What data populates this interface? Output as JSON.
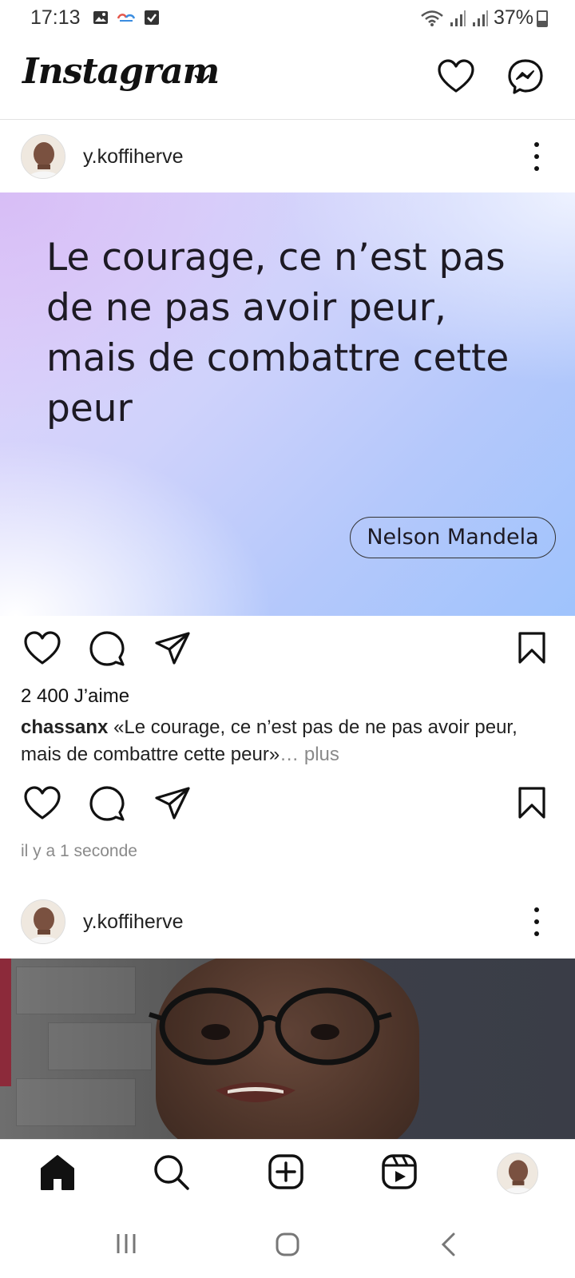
{
  "status_bar": {
    "time": "17:13",
    "battery": "37%",
    "battery_level": 0.37,
    "left_icons": [
      "image-icon",
      "cloud-icon",
      "checkbox-icon"
    ],
    "right_icons": [
      "wifi-icon",
      "signal-icon",
      "signal-icon"
    ]
  },
  "header": {
    "logo": "Instagram",
    "icons": [
      "chevron-down-icon",
      "heart-icon",
      "messenger-icon"
    ]
  },
  "posts": [
    {
      "username": "y.koffiherve",
      "quote_lines": [
        "Le courage, ce n’est pas",
        "de ne pas avoir peur,",
        "mais de combattre cette",
        "peur"
      ],
      "author": "Nelson Mandela",
      "likes": "2 400 J’aime",
      "caption_user": "chassanx",
      "caption_text": " «Le courage, ce n’est pas de ne pas avoir peur, mais de combattre cette peur»",
      "caption_more": "… plus",
      "timestamp": "il y a 1 seconde"
    },
    {
      "username": "y.koffiherve"
    }
  ],
  "bottom_nav": [
    "home-icon",
    "search-icon",
    "create-icon",
    "reels-icon",
    "profile-avatar"
  ],
  "system_nav": [
    "recents-icon",
    "home-circle-icon",
    "back-icon"
  ],
  "colors": {
    "text": "#111111",
    "muted": "#8a8a8a",
    "divider": "#e2e2e2",
    "gradient_purple": "#d7bdf6",
    "gradient_blue": "#9fc3fc"
  }
}
